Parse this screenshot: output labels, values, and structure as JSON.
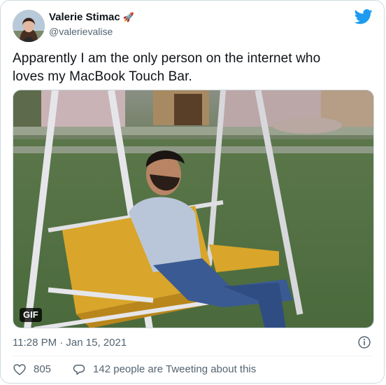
{
  "author": {
    "name": "Valerie Stimac",
    "handle": "@valerievalise",
    "name_emoji": "🚀"
  },
  "tweet": {
    "text_line1": "Apparently I am the only person on the internet who",
    "text_line2": "loves my MacBook Touch Bar."
  },
  "media": {
    "badge": "GIF"
  },
  "meta": {
    "timestamp": "11:28 PM · Jan 15, 2021"
  },
  "actions": {
    "like_count": "805",
    "reply_text": "142 people are Tweeting about this"
  },
  "colors": {
    "brand": "#1d9bf0",
    "muted": "#536471",
    "border": "#cfd9de"
  },
  "icons": {
    "brand": "twitter-bird-icon",
    "info": "info-icon",
    "like": "heart-icon",
    "reply": "speech-bubble-icon"
  }
}
